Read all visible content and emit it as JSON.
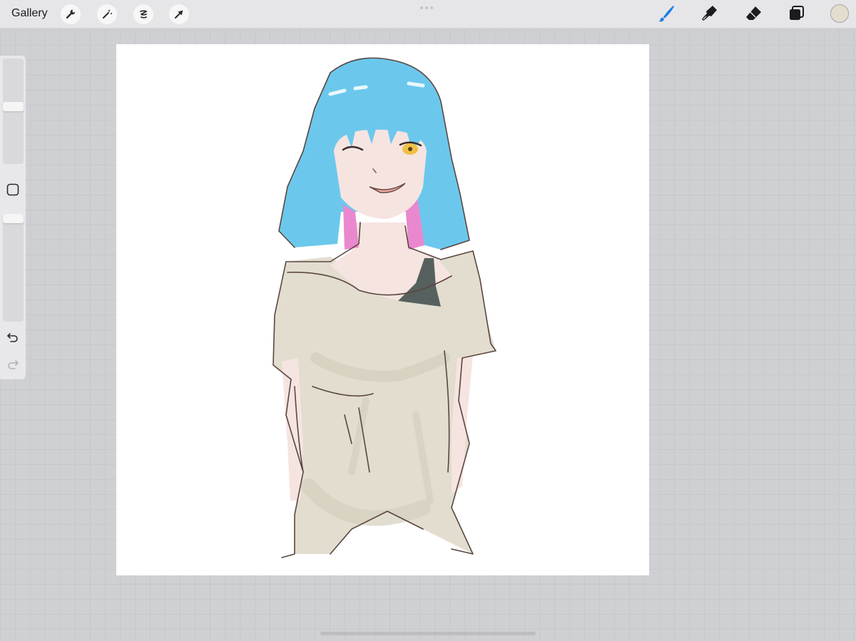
{
  "topbar": {
    "gallery_label": "Gallery",
    "left_tools": [
      "wrench-icon",
      "magic-wand-icon",
      "selection-icon",
      "transform-arrow-icon"
    ],
    "right_tools": [
      "paintbrush-icon",
      "smudge-icon",
      "eraser-icon",
      "layers-icon"
    ],
    "active_tool": "paintbrush-icon",
    "accent_color": "#1e7ee6",
    "current_color": "#e3ddcd"
  },
  "sidebar": {
    "brush_size_level": 0.55,
    "opacity_level": 1.0,
    "controls": [
      "brush-size-slider",
      "modify-button",
      "opacity-slider",
      "undo-icon",
      "redo-icon"
    ]
  },
  "artwork": {
    "subject": "drawing",
    "palette": {
      "hair": "#6bc8ec",
      "hair_tips": "#ea88cf",
      "skin": "#f6e4e1",
      "shirt": "#e2ddcf",
      "strap": "#56615f",
      "lines": "#5a4640",
      "eye": "#f0c043"
    }
  }
}
